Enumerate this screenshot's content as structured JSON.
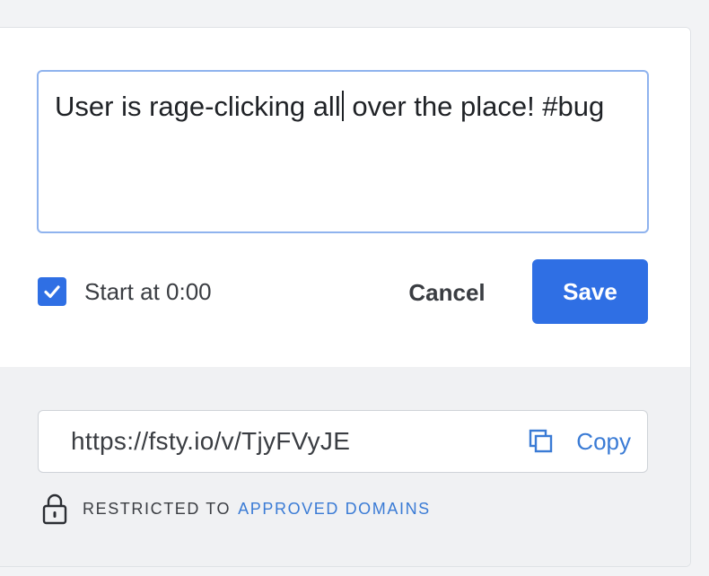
{
  "note": {
    "text_before_caret": "User is rage-clicking all",
    "text_after_caret": " over the place! #bug"
  },
  "controls": {
    "start_at_label": "Start at 0:00",
    "start_at_checked": true,
    "cancel_label": "Cancel",
    "save_label": "Save"
  },
  "share": {
    "url": "https://fsty.io/v/TjyFVyJE",
    "copy_label": "Copy",
    "copy_icon": "copy-icon",
    "restriction_prefix": "RESTRICTED TO",
    "restriction_link": "APPROVED DOMAINS",
    "lock_icon": "lock-icon"
  },
  "colors": {
    "accent": "#2f6fe4",
    "link": "#3a7bd5",
    "focus_border": "#8fb3ee"
  }
}
